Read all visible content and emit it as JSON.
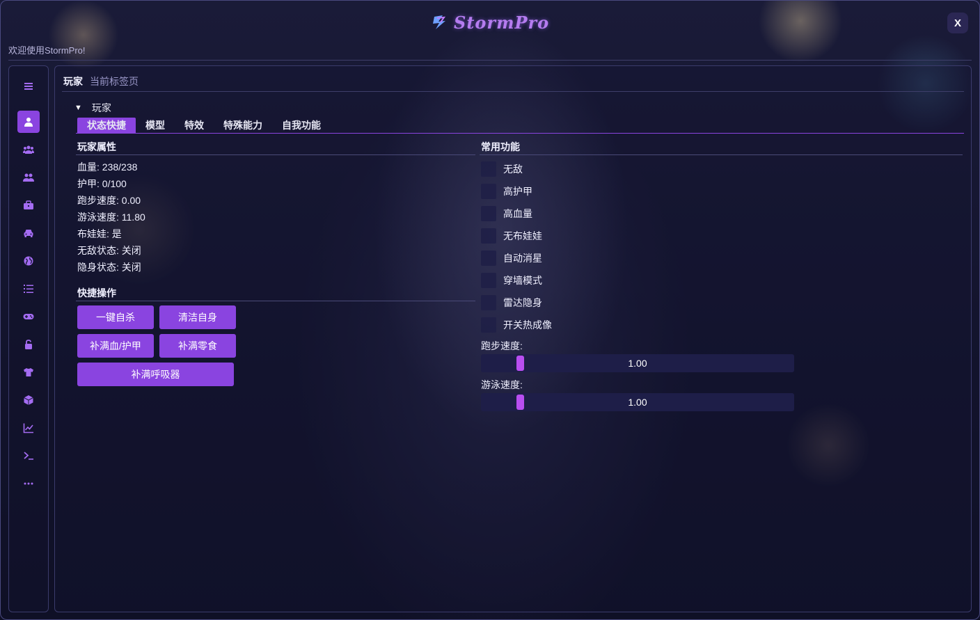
{
  "app": {
    "logo_text": "StormPro",
    "welcome": "欢迎使用StormPro!",
    "close_label": "X"
  },
  "sidebar": {
    "items": [
      {
        "icon": "menu-icon"
      },
      {
        "icon": "user-icon"
      },
      {
        "icon": "users-group-icon"
      },
      {
        "icon": "user-pair-icon"
      },
      {
        "icon": "briefcase-icon"
      },
      {
        "icon": "car-icon"
      },
      {
        "icon": "globe-icon"
      },
      {
        "icon": "list-icon"
      },
      {
        "icon": "gamepad-icon"
      },
      {
        "icon": "lock-icon"
      },
      {
        "icon": "shirt-icon"
      },
      {
        "icon": "cube-icon"
      },
      {
        "icon": "chart-icon"
      },
      {
        "icon": "terminal-icon"
      },
      {
        "icon": "more-icon"
      }
    ],
    "active_index": 1
  },
  "breadcrumb": {
    "section": "玩家",
    "current": "当前标签页"
  },
  "section": {
    "title": "玩家"
  },
  "tabs": [
    "状态快捷",
    "模型",
    "特效",
    "特殊能力",
    "自我功能"
  ],
  "player_attrs": {
    "title": "玩家属性",
    "items": [
      "血量: 238/238",
      "护甲: 0/100",
      "跑步速度: 0.00",
      "游泳速度: 11.80",
      "布娃娃: 是",
      "无敌状态: 关闭",
      "隐身状态: 关闭"
    ]
  },
  "quick_ops": {
    "title": "快捷操作",
    "buttons": [
      "一键自杀",
      "清洁自身",
      "补满血/护甲",
      "补满零食",
      "补满呼吸器"
    ]
  },
  "common": {
    "title": "常用功能",
    "toggles": [
      "无敌",
      "高护甲",
      "高血量",
      "无布娃娃",
      "自动消星",
      "穿墙模式",
      "雷达隐身",
      "开关热成像"
    ],
    "sliders": [
      {
        "label": "跑步速度:",
        "value": "1.00"
      },
      {
        "label": "游泳速度:",
        "value": "1.00"
      }
    ]
  },
  "colors": {
    "accent": "#8a44e0",
    "slider_grab": "#b84ef0",
    "background": "#12132c"
  }
}
